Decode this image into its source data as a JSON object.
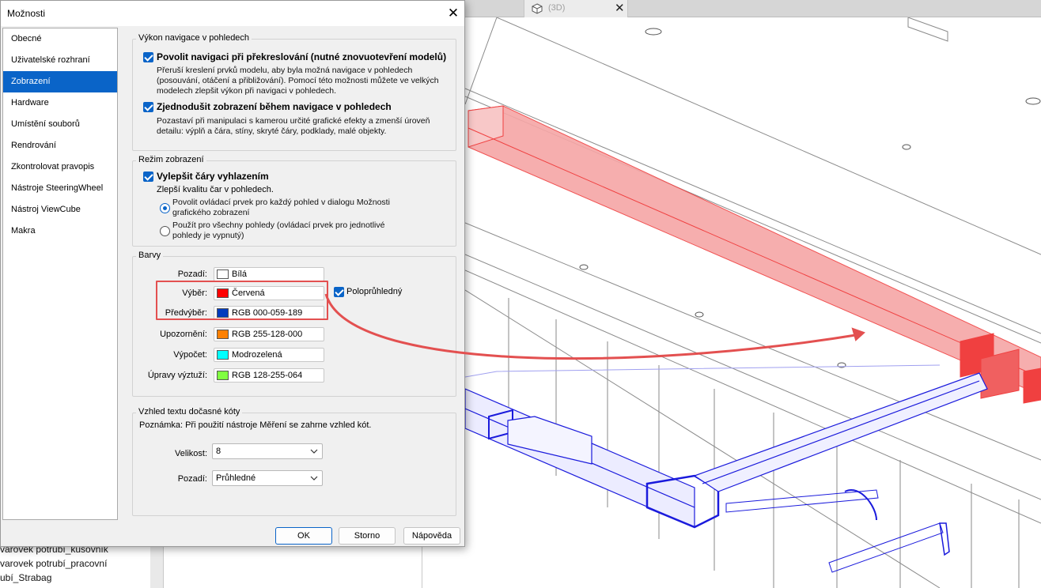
{
  "background": {
    "tab": {
      "label": "(3D)",
      "icon": "cube-icon"
    },
    "browser_items": [
      "varovek potrubí_kusovník",
      "varovek potrubí_pracovní",
      "ubí_Strabag"
    ],
    "colors": {
      "selection": "#f15a5a",
      "preselection": "#1a1adc",
      "model_lines": "#7a7a7a"
    }
  },
  "dialog": {
    "title": "Možnosti",
    "nav": {
      "selected_index": 2,
      "items": [
        "Obecné",
        "Uživatelské rozhraní",
        "Zobrazení",
        "Hardware",
        "Umístění souborů",
        "Rendrování",
        "Zkontrolovat pravopis",
        "Nástroje SteeringWheel",
        "Nástroj ViewCube",
        "Makra"
      ]
    },
    "nav_performance": {
      "title": "Výkon navigace v pohledech",
      "opt1": {
        "label": "Povolit navigaci při překreslování (nutné znovuotevření modelů)",
        "checked": true,
        "desc": "Přeruší kreslení prvků modelu, aby byla možná navigace v pohledech (posouvání, otáčení a přibližování). Pomocí této možnosti můžete ve velkých modelech zlepšit výkon při navigaci v pohledech."
      },
      "opt2": {
        "label": "Zjednodušit zobrazení během navigace v pohledech",
        "checked": true,
        "desc": "Pozastaví při manipulaci s kamerou určité grafické efekty a zmenší úroveň detailu: výplň a čára, stíny, skryté čáry, podklady, malé objekty."
      }
    },
    "display_mode": {
      "title": "Režim zobrazení",
      "smooth": {
        "label": "Vylepšit čáry vyhlazením",
        "checked": true,
        "desc": "Zlepší kvalitu čar v pohledech."
      },
      "radio1": {
        "label": "Povolit ovládací prvek pro každý pohled v dialogu Možnosti grafického zobrazení",
        "selected": true
      },
      "radio2": {
        "label": "Použít pro všechny pohledy (ovládací prvek pro jednotlivé pohledy je vypnutý)",
        "selected": false
      }
    },
    "colors": {
      "title": "Barvy",
      "rows": [
        {
          "label": "Pozadí:",
          "value": "Bílá",
          "color": "#ffffff"
        },
        {
          "label": "Výběr:",
          "value": "Červená",
          "color": "#ff0000"
        },
        {
          "label": "Předvýběr:",
          "value": "RGB 000-059-189",
          "color": "#003bbd"
        },
        {
          "label": "Upozornění:",
          "value": "RGB 255-128-000",
          "color": "#ff8000"
        },
        {
          "label": "Výpočet:",
          "value": "Modrozelená",
          "color": "#00ffff"
        },
        {
          "label": "Úpravy výztuží:",
          "value": "RGB 128-255-064",
          "color": "#80ff40"
        }
      ],
      "semitransparent": {
        "label": "Poloprůhledný",
        "checked": true
      }
    },
    "temp_dim": {
      "title": "Vzhled textu dočasné kóty",
      "note": "Poznámka: Při použití nástroje Měření se zahrne vzhled kót.",
      "size_label": "Velikost:",
      "size_value": "8",
      "bg_label": "Pozadí:",
      "bg_value": "Průhledné"
    },
    "buttons": {
      "ok": "OK",
      "cancel": "Storno",
      "help": "Nápověda"
    },
    "annotation_color": "#e35050"
  }
}
